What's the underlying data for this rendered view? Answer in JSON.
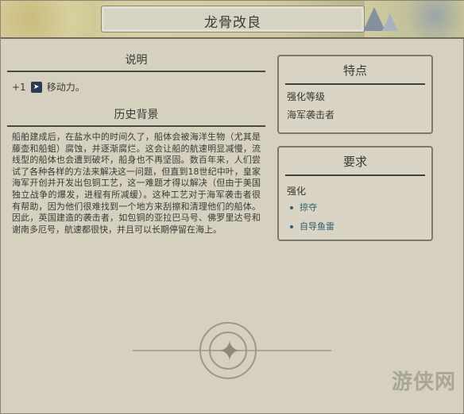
{
  "window": {
    "title": "龙骨改良"
  },
  "left": {
    "description_header": "说明",
    "effect": {
      "value": "+1",
      "icon": "movement-icon",
      "label": "移动力。"
    },
    "history_header": "历史背景",
    "history_text": "船舶建成后，在盐水中的时间久了，船体会被海洋生物（尤其是藤壶和船蛆）腐蚀，并逐渐腐烂。这会让船的航速明显减慢，流线型的船体也会遭到破坏，船身也不再坚固。数百年来，人们尝试了各种各样的方法来解决这一问题，但直到18世纪中叶，皇家海军开创并开发出包铜工艺，这一难题才得以解决（但由于美国独立战争的爆发，进程有所减缓）。这种工艺对于海军袭击者很有帮助，因为他们很难找到一个地方来刮擦和清理他们的船体。因此，英国建造的袭击者，如包铜的亚拉巴马号、佛罗里达号和谢南多厄号，航速都很快，并且可以长期停留在海上。"
  },
  "features": {
    "header": "特点",
    "upgrade_label": "强化等级",
    "upgrade_value": "海军袭击者"
  },
  "requirements": {
    "header": "要求",
    "sub_label": "强化",
    "items": [
      "掠夺",
      "自导鱼雷"
    ]
  },
  "watermark": "游侠网",
  "colors": {
    "link": "#2e5f6e",
    "text": "#3a3a36",
    "background": "#d6d1bf"
  }
}
